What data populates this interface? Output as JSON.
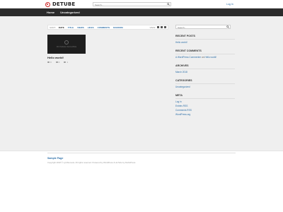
{
  "header": {
    "logo_text": "DETUBE",
    "search": {
      "placeholder": "Search..."
    },
    "login_label": "Log In"
  },
  "nav": {
    "items": [
      "Home",
      "Uncategorized"
    ]
  },
  "sortbar": {
    "sort_label": "SORT:",
    "options": [
      "DATE",
      "TITLE",
      "VIEWS",
      "LIKES",
      "COMMENTS",
      "RANDOM"
    ],
    "view_label": "VIEW:"
  },
  "post": {
    "thumb_text": "NO IMAGE AVAILABLE",
    "title": "Hello world!",
    "views": "0",
    "likes": "0",
    "comments": "1"
  },
  "sidebar": {
    "search": {
      "placeholder": "Search..."
    },
    "recent_posts": {
      "title": "RECENT POSTS",
      "items": [
        "Hello world!"
      ]
    },
    "recent_comments": {
      "title": "RECENT COMMENTS",
      "author": "A WordPress Commenter",
      "on": "on",
      "post": "Hello world!"
    },
    "archives": {
      "title": "ARCHIVES",
      "items": [
        "March 2018"
      ]
    },
    "categories": {
      "title": "CATEGORIES",
      "items": [
        "Uncategorized"
      ]
    },
    "meta": {
      "title": "META",
      "items": [
        "Log in",
        "Entries RSS",
        "Comments RSS",
        "WordPress.org"
      ]
    }
  },
  "footer": {
    "title": "Sample Page",
    "copyright": "Copyright 2018 © cynthia tests. All rights reserved. Powered by WordPress & deTube by DeDePress"
  },
  "colors": {
    "brand": "#cc2222",
    "link": "#2d6fa8",
    "nav_bg": "#2b2b2b",
    "page_bg": "#efefef"
  }
}
